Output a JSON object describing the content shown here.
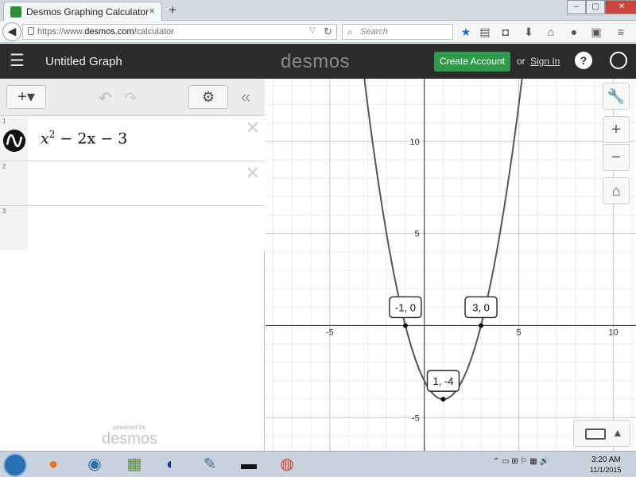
{
  "browser": {
    "tab_title": "Desmos Graphing Calculator",
    "tab_close": "×",
    "new_tab": "+",
    "url_prefix": "https://www.",
    "url_domain": "desmos.com",
    "url_path": "/calculator",
    "search_placeholder": "Search",
    "window_buttons": [
      "–",
      "▢",
      "✕"
    ]
  },
  "header": {
    "title": "Untitled Graph",
    "logo": "desmos",
    "create_account": "Create Account",
    "or": "or",
    "sign_in": "Sign In",
    "help": "?",
    "brand_color": "#2f9a4a"
  },
  "expressions": [
    {
      "index": "1",
      "latex_parts": {
        "base": "x",
        "exp": "2",
        "rest": " − 2x − 3"
      },
      "has_graph_icon": true
    },
    {
      "index": "2",
      "latex_parts": null
    },
    {
      "index": "3",
      "latex_parts": null
    }
  ],
  "expression_toolbar": {
    "add": "+▾",
    "settings": "⚙",
    "collapse": "«"
  },
  "footer_brand": {
    "powered_by": "powered by",
    "logo": "desmos"
  },
  "graph": {
    "xmin": -8.4,
    "xmax": 11.2,
    "ymin": -6.8,
    "ymax": 13.4,
    "major_step": 5,
    "minor_step": 1,
    "x_ticks": [
      -5,
      5,
      10
    ],
    "y_ticks": [
      -5,
      5,
      10
    ],
    "curve": {
      "expression": "x^2 - 2x - 3",
      "a": 1,
      "b": -2,
      "c": -3,
      "color": "#555555"
    },
    "points": [
      {
        "x": -1,
        "y": 0,
        "label": "-1, 0"
      },
      {
        "x": 3,
        "y": 0,
        "label": "3, 0"
      },
      {
        "x": 1,
        "y": -4,
        "label": "1, -4"
      }
    ]
  },
  "controls": {
    "wrench": "🔧",
    "zoom_in": "+",
    "zoom_out": "−",
    "home": "⌂",
    "keypad_arrow": "▲"
  },
  "taskbar": {
    "time": "3:20 AM",
    "date": "11/1/2015",
    "tray": "⌃ ▭ ⊞ ⚐ ▦ 🔊"
  }
}
